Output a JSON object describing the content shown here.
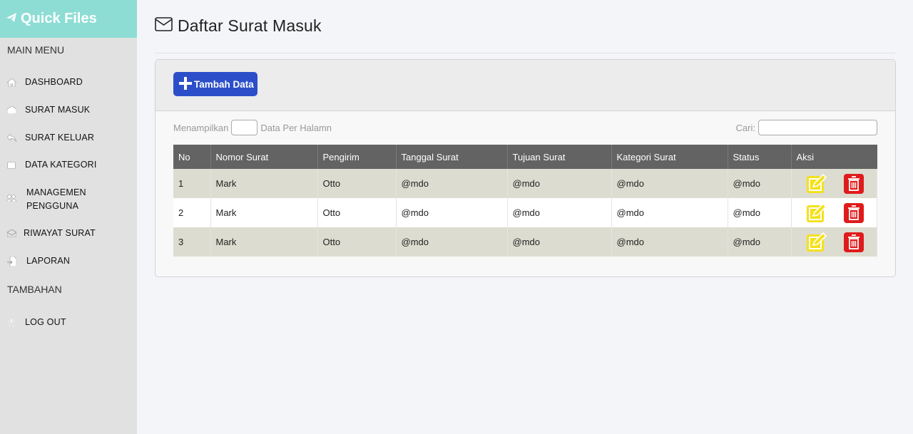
{
  "app": {
    "title": "Quick Files"
  },
  "sidebar": {
    "main_menu_title": "MAIN MENU",
    "extra_title": "TAMBAHAN",
    "items": [
      {
        "label": "DASHBOARD",
        "icon": "home-icon"
      },
      {
        "label": "SURAT MASUK",
        "icon": "inbox-envelope-icon"
      },
      {
        "label": "SURAT KELUAR",
        "icon": "reply-arrow-icon"
      },
      {
        "label": "DATA KATEGORI",
        "icon": "address-card-icon"
      },
      {
        "label": "MANAGEMEN PENGGUNA",
        "icon": "users-icon"
      },
      {
        "label": "RIWAYAT SURAT",
        "icon": "open-envelope-icon"
      },
      {
        "label": "LAPORAN",
        "icon": "file-import-icon"
      }
    ],
    "logout": {
      "label": "LOG OUT",
      "icon": "power-icon"
    }
  },
  "page": {
    "title": "Daftar Surat Masuk"
  },
  "toolbar": {
    "add_label": "Tambah Data"
  },
  "controls": {
    "show_prefix": "Menampilkan",
    "show_suffix": "Data Per Halamn",
    "show_value": "",
    "search_label": "Cari:",
    "search_value": ""
  },
  "table": {
    "columns": [
      "No",
      "Nomor Surat",
      "Pengirim",
      "Tanggal Surat",
      "Tujuan Surat",
      "Kategori Surat",
      "Status",
      "Aksi"
    ],
    "rows": [
      [
        "1",
        "Mark",
        "Otto",
        "@mdo",
        "@mdo",
        "@mdo",
        "@mdo"
      ],
      [
        "2",
        "Mark",
        "Otto",
        "@mdo",
        "@mdo",
        "@mdo",
        "@mdo"
      ],
      [
        "3",
        "Mark",
        "Otto",
        "@mdo",
        "@mdo",
        "@mdo",
        "@mdo"
      ]
    ]
  },
  "colors": {
    "brand": "#8dddd5",
    "primary_button": "#2c4fc9",
    "edit": "#f5e11b",
    "delete": "#e01b1b",
    "table_header": "#636363",
    "row_stripe": "#dcdcd0"
  }
}
